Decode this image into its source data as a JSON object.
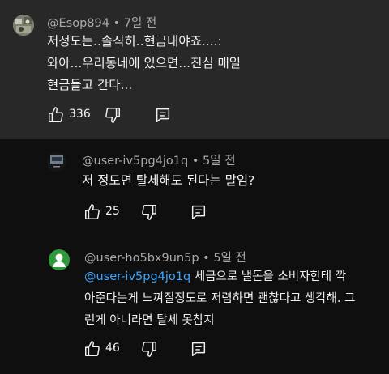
{
  "comments": [
    {
      "author": "@Esop894",
      "time": "7일 전",
      "lines": [
        "저정도는..솔직히..현금내야죠....:",
        "와아...우리동네에 있으면...진심 매일",
        "현금들고 간다..."
      ],
      "likes": "336"
    },
    {
      "author": "@user-iv5pg4jo1q",
      "time": "5일 전",
      "lines": [
        "저 정도면 탈세해도 된다는 말임?"
      ],
      "likes": "25"
    },
    {
      "author": "@user-ho5bx9un5p",
      "time": "5일 전",
      "mention": "@user-iv5pg4jo1q",
      "first_line_rest": " 세금으로 낼돈을 소비자한테 깍",
      "lines": [
        "아준다는게 느껴질정도로 저렴하면 괜찮다고 생각해. 그",
        "런게 아니라면 탈세 못참지"
      ],
      "likes": "46"
    }
  ],
  "meta_separator": "•",
  "icons": [
    "thumb-up-icon",
    "thumb-down-icon",
    "reply-icon",
    "avatar-icon"
  ],
  "colors": {
    "top_panel": "#282828",
    "background": "#0f0f0f",
    "mention": "#3ea6ff",
    "meta": "#aaaaaa",
    "avatar_green": "#2e9a3c"
  }
}
